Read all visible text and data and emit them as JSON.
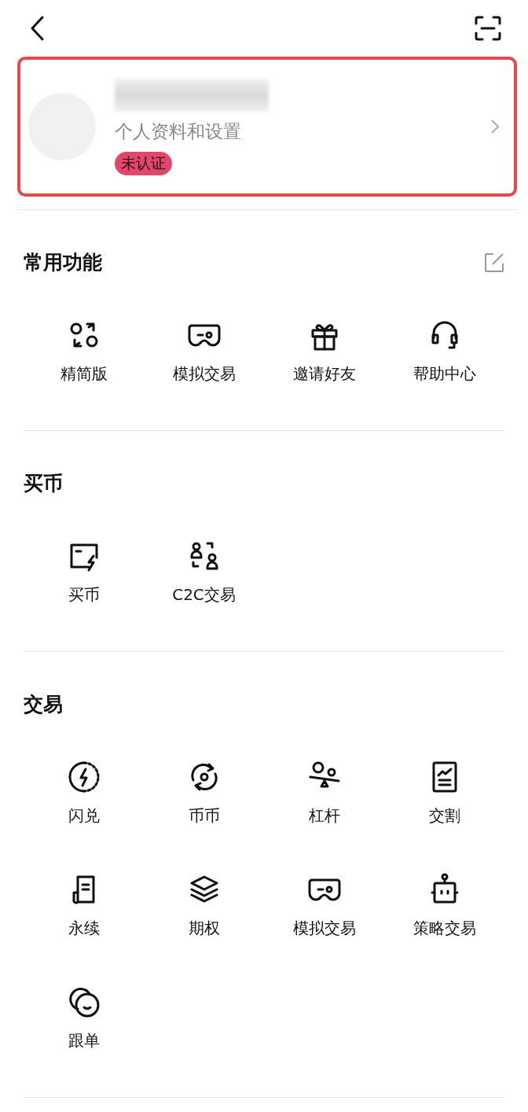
{
  "profile": {
    "subtitle": "个人资料和设置",
    "badge": "未认证"
  },
  "sections": [
    {
      "title": "常用功能",
      "has_edit": true,
      "items": [
        {
          "label": "精简版",
          "kind": "swap"
        },
        {
          "label": "模拟交易",
          "kind": "gamepad"
        },
        {
          "label": "邀请好友",
          "kind": "gift"
        },
        {
          "label": "帮助中心",
          "kind": "headset"
        }
      ]
    },
    {
      "title": "买币",
      "has_edit": false,
      "items": [
        {
          "label": "买币",
          "kind": "card"
        },
        {
          "label": "C2C交易",
          "kind": "c2c"
        }
      ]
    },
    {
      "title": "交易",
      "has_edit": false,
      "items": [
        {
          "label": "闪兑",
          "kind": "flash"
        },
        {
          "label": "币币",
          "kind": "cycle"
        },
        {
          "label": "杠杆",
          "kind": "seesaw"
        },
        {
          "label": "交割",
          "kind": "report"
        },
        {
          "label": "永续",
          "kind": "scroll"
        },
        {
          "label": "期权",
          "kind": "layers"
        },
        {
          "label": "模拟交易",
          "kind": "gamepad"
        },
        {
          "label": "策略交易",
          "kind": "robot"
        },
        {
          "label": "跟单",
          "kind": "coins"
        }
      ]
    }
  ]
}
